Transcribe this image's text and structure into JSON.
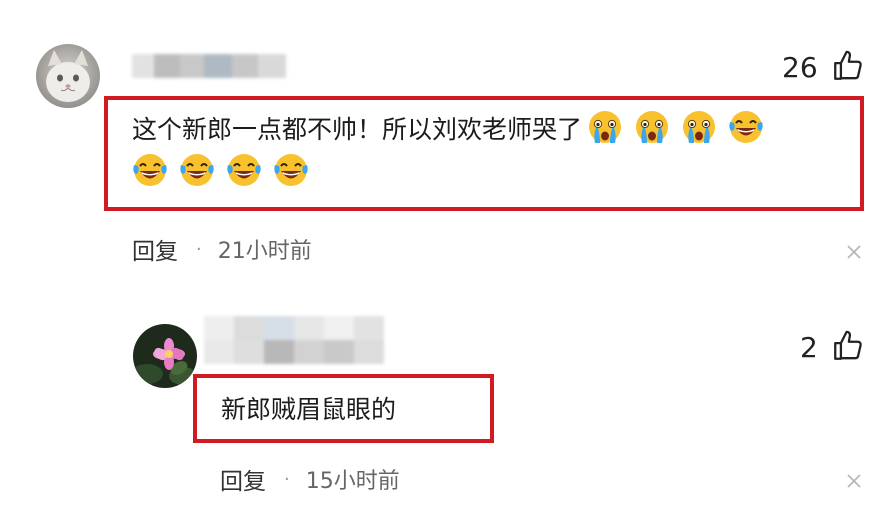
{
  "comments": [
    {
      "username_blurred": true,
      "likes": "26",
      "text": "这个新郎一点都不帅！所以刘欢老师哭了",
      "reply_label": "回复",
      "separator": "·",
      "time": "21小时前",
      "emojis": [
        "crying-face",
        "crying-face",
        "crying-face",
        "laugh-cry-face",
        "laugh-cry-face",
        "laugh-cry-face",
        "laugh-cry-face",
        "laugh-cry-face"
      ]
    },
    {
      "username_blurred": true,
      "likes": "2",
      "text": "新郎贼眉鼠眼的",
      "reply_label": "回复",
      "separator": "·",
      "time": "15小时前"
    }
  ],
  "colors": {
    "highlight_border": "#d01b22",
    "emoji_yellow": "#f7c22e",
    "emoji_tears": "#3aa6f0"
  },
  "icons": [
    "thumbs-up-icon",
    "close-icon",
    "crying-face-emoji",
    "laugh-cry-face-emoji"
  ]
}
